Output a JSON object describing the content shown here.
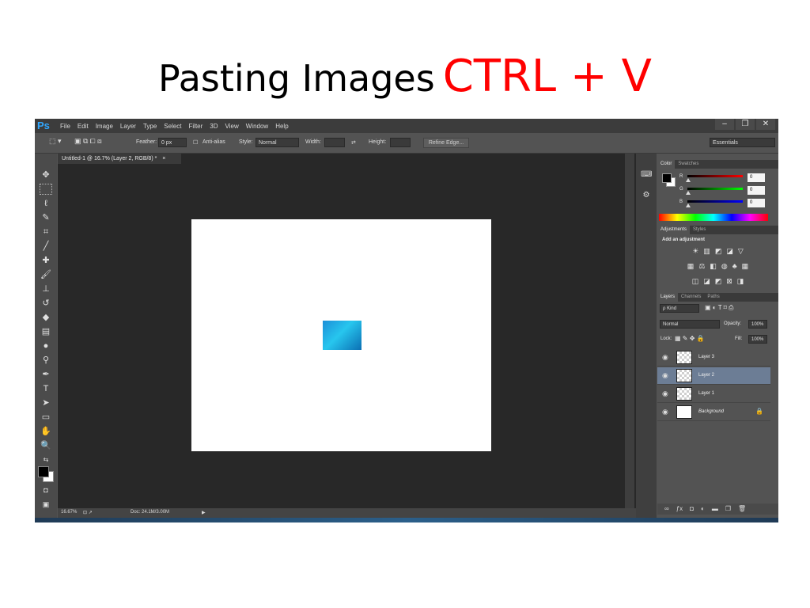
{
  "slide": {
    "title": "Pasting Images",
    "shortcut": "CTRL + V"
  },
  "colors": {
    "accent": "#ff0000",
    "ps_logo": "#31a8ff",
    "selected_layer": "#6c7d95",
    "canvas": "#ffffff",
    "pasted_image": "#1fa9e6"
  },
  "app": {
    "logo": "Ps",
    "menu": [
      "File",
      "Edit",
      "Image",
      "Layer",
      "Type",
      "Select",
      "Filter",
      "3D",
      "View",
      "Window",
      "Help"
    ],
    "window_buttons": [
      "minimize-icon",
      "restore-icon",
      "close-icon"
    ]
  },
  "options_bar": {
    "feather_label": "Feather:",
    "feather_value": "0 px",
    "antialias_label": "Anti-alias",
    "style_label": "Style:",
    "style_value": "Normal",
    "width_label": "Width:",
    "height_label": "Height:",
    "refine_edge": "Refine Edge...",
    "workspace": "Essentials"
  },
  "document": {
    "tab_label": "Untitled-1 @ 16.7% (Layer 2, RGB/8) *",
    "tab_close": "×",
    "zoom": "16.67%",
    "doc_info": "Doc: 24.1M/3.00M"
  },
  "color_panel": {
    "tabs": [
      "Color",
      "Swatches"
    ],
    "channels": [
      {
        "label": "R",
        "value": "0",
        "color": "#ff0000"
      },
      {
        "label": "G",
        "value": "0",
        "color": "#00ff00"
      },
      {
        "label": "B",
        "value": "0",
        "color": "#0000ff"
      }
    ]
  },
  "adjustments_panel": {
    "tabs": [
      "Adjustments",
      "Styles"
    ],
    "heading": "Add an adjustment"
  },
  "layers_panel": {
    "tabs": [
      "Layers",
      "Channels",
      "Paths"
    ],
    "filter_kind": "ρ Kind",
    "blend_mode": "Normal",
    "opacity_label": "Opacity:",
    "opacity_value": "100%",
    "lock_label": "Lock:",
    "fill_label": "Fill:",
    "fill_value": "100%",
    "layers": [
      {
        "name": "Layer 3",
        "selected": false
      },
      {
        "name": "Layer 2",
        "selected": true
      },
      {
        "name": "Layer 1",
        "selected": false
      },
      {
        "name": "Background",
        "selected": false,
        "locked": true
      }
    ]
  }
}
